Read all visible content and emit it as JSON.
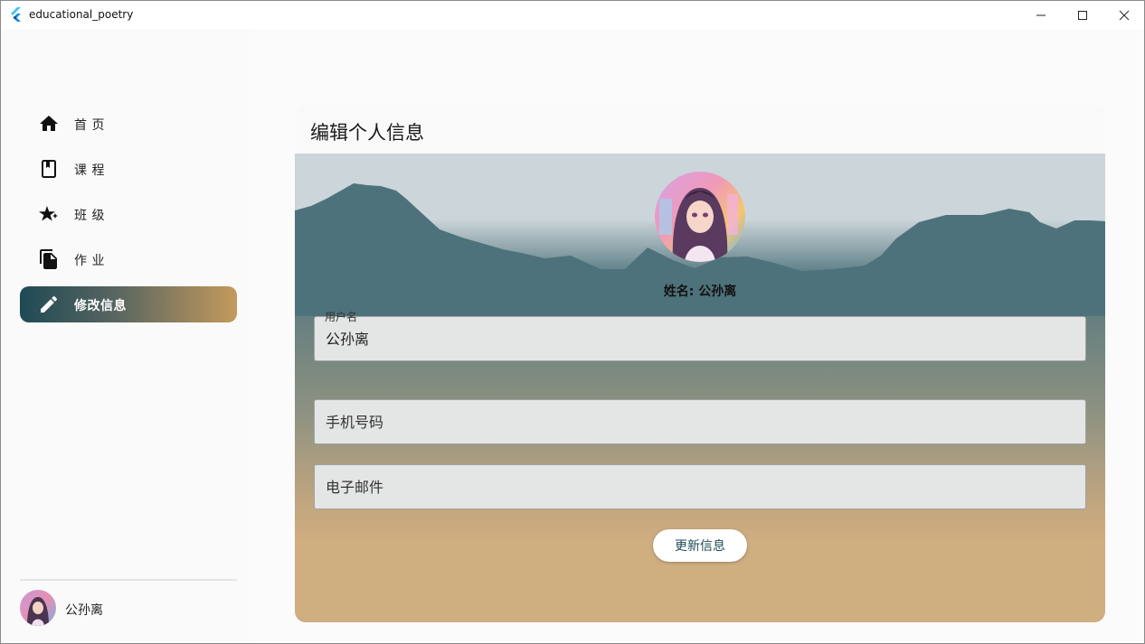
{
  "window": {
    "title": "educational_poetry"
  },
  "sidebar": {
    "items": [
      {
        "label": "首 页",
        "icon": "home-icon"
      },
      {
        "label": "课 程",
        "icon": "book-icon"
      },
      {
        "label": "班 级",
        "icon": "stars-icon"
      },
      {
        "label": "作 业",
        "icon": "copy-icon"
      },
      {
        "label": "修改信息",
        "icon": "edit-icon",
        "active": true
      }
    ],
    "user": {
      "name": "公孙离"
    }
  },
  "main": {
    "card_title": "编辑个人信息",
    "profile_name": "姓名: 公孙离",
    "fields": {
      "username": {
        "label": "用户名",
        "value": "公孙离"
      },
      "phone": {
        "placeholder": "手机号码"
      },
      "email": {
        "placeholder": "电子邮件"
      }
    },
    "update_button": "更新信息"
  },
  "colors": {
    "active_gradient_start": "#1f4a55",
    "active_gradient_end": "#c49a5c",
    "mountain": "#4e727b",
    "sky": "#cbd5da",
    "sand": "#cfae80"
  }
}
